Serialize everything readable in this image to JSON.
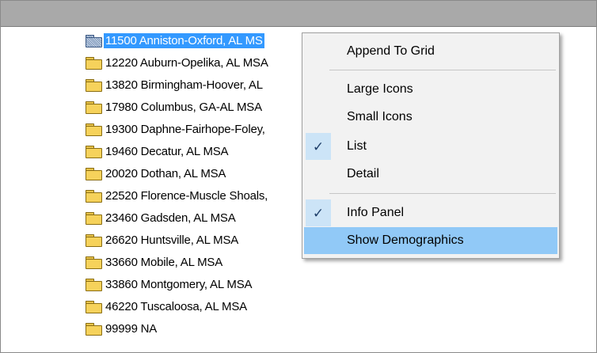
{
  "list": {
    "items": [
      {
        "label": "11500 Anniston-Oxford, AL MS",
        "selected": true
      },
      {
        "label": "12220 Auburn-Opelika, AL MSA",
        "selected": false
      },
      {
        "label": "13820 Birmingham-Hoover, AL",
        "selected": false
      },
      {
        "label": "17980 Columbus, GA-AL MSA",
        "selected": false
      },
      {
        "label": "19300 Daphne-Fairhope-Foley,",
        "selected": false
      },
      {
        "label": "19460 Decatur, AL MSA",
        "selected": false
      },
      {
        "label": "20020 Dothan, AL MSA",
        "selected": false
      },
      {
        "label": "22520 Florence-Muscle Shoals,",
        "selected": false
      },
      {
        "label": "23460 Gadsden, AL MSA",
        "selected": false
      },
      {
        "label": "26620 Huntsville, AL MSA",
        "selected": false
      },
      {
        "label": "33660 Mobile, AL MSA",
        "selected": false
      },
      {
        "label": "33860 Montgomery, AL MSA",
        "selected": false
      },
      {
        "label": "46220 Tuscaloosa, AL MSA",
        "selected": false
      },
      {
        "label": "99999 NA",
        "selected": false
      }
    ]
  },
  "context_menu": {
    "append_to_grid": "Append To Grid",
    "large_icons": "Large Icons",
    "small_icons": "Small Icons",
    "list": "List",
    "detail": "Detail",
    "info_panel": "Info Panel",
    "show_demographics": "Show Demographics",
    "check_glyph": "✓",
    "checked_items": [
      "List",
      "Info Panel"
    ],
    "highlighted_item": "Show Demographics"
  },
  "icons": {
    "folder": "folder-icon",
    "check": "checkmark-icon"
  },
  "colors": {
    "selection": "#3399ff",
    "menu_hover": "#91c9f7",
    "check_background": "#cce4f7",
    "header_bar": "#a9a9a9"
  }
}
